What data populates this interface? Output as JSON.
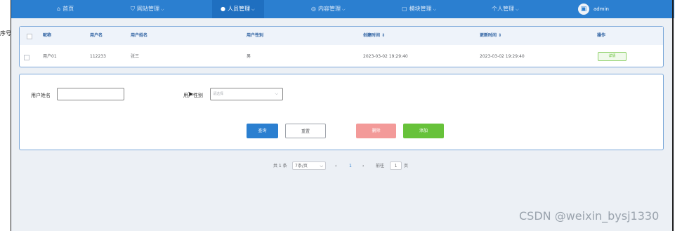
{
  "nav": {
    "items": [
      {
        "icon": "home-icon",
        "label": "首页",
        "active": false
      },
      {
        "icon": "cart-icon",
        "label": "网站管理",
        "active": false
      },
      {
        "icon": "user-icon",
        "label": "人员管理",
        "active": true
      },
      {
        "icon": "chat-icon",
        "label": "内容管理",
        "active": false
      },
      {
        "icon": "box-icon",
        "label": "模块管理",
        "active": false
      },
      {
        "icon": "",
        "label": "个人管理",
        "active": false
      }
    ],
    "username": "admin"
  },
  "edge_label": "序号",
  "table": {
    "columns": [
      "昵称",
      "用户名",
      "用户姓名",
      "用户性别",
      "创建时间 ⇕",
      "更新时间 ⇕",
      "操作"
    ],
    "rows": [
      {
        "nickname": "用户01",
        "username": "112233",
        "realname": "张三",
        "gender": "男",
        "created": "2023-03-02 19:29:40",
        "updated": "2023-03-02 19:29:40",
        "action": "详情"
      }
    ]
  },
  "search": {
    "name_label": "用户姓名",
    "name_value": "",
    "gender_label": "用户性别",
    "gender_placeholder": "请选择",
    "query_label": "查询",
    "reset_label": "重置",
    "delete_label": "删除",
    "add_label": "添加"
  },
  "pagination": {
    "total": "共 1 条",
    "page_size": "7条/页",
    "current": "1",
    "goto_label": "前往",
    "goto_value": "1",
    "page_suffix": "页"
  },
  "watermark": "CSDN @weixin_bysj1330",
  "colors": {
    "nav_bg": "#2b7fd0",
    "accent": "#2b7fd0",
    "success": "#67c23a",
    "danger": "#f39a99"
  }
}
